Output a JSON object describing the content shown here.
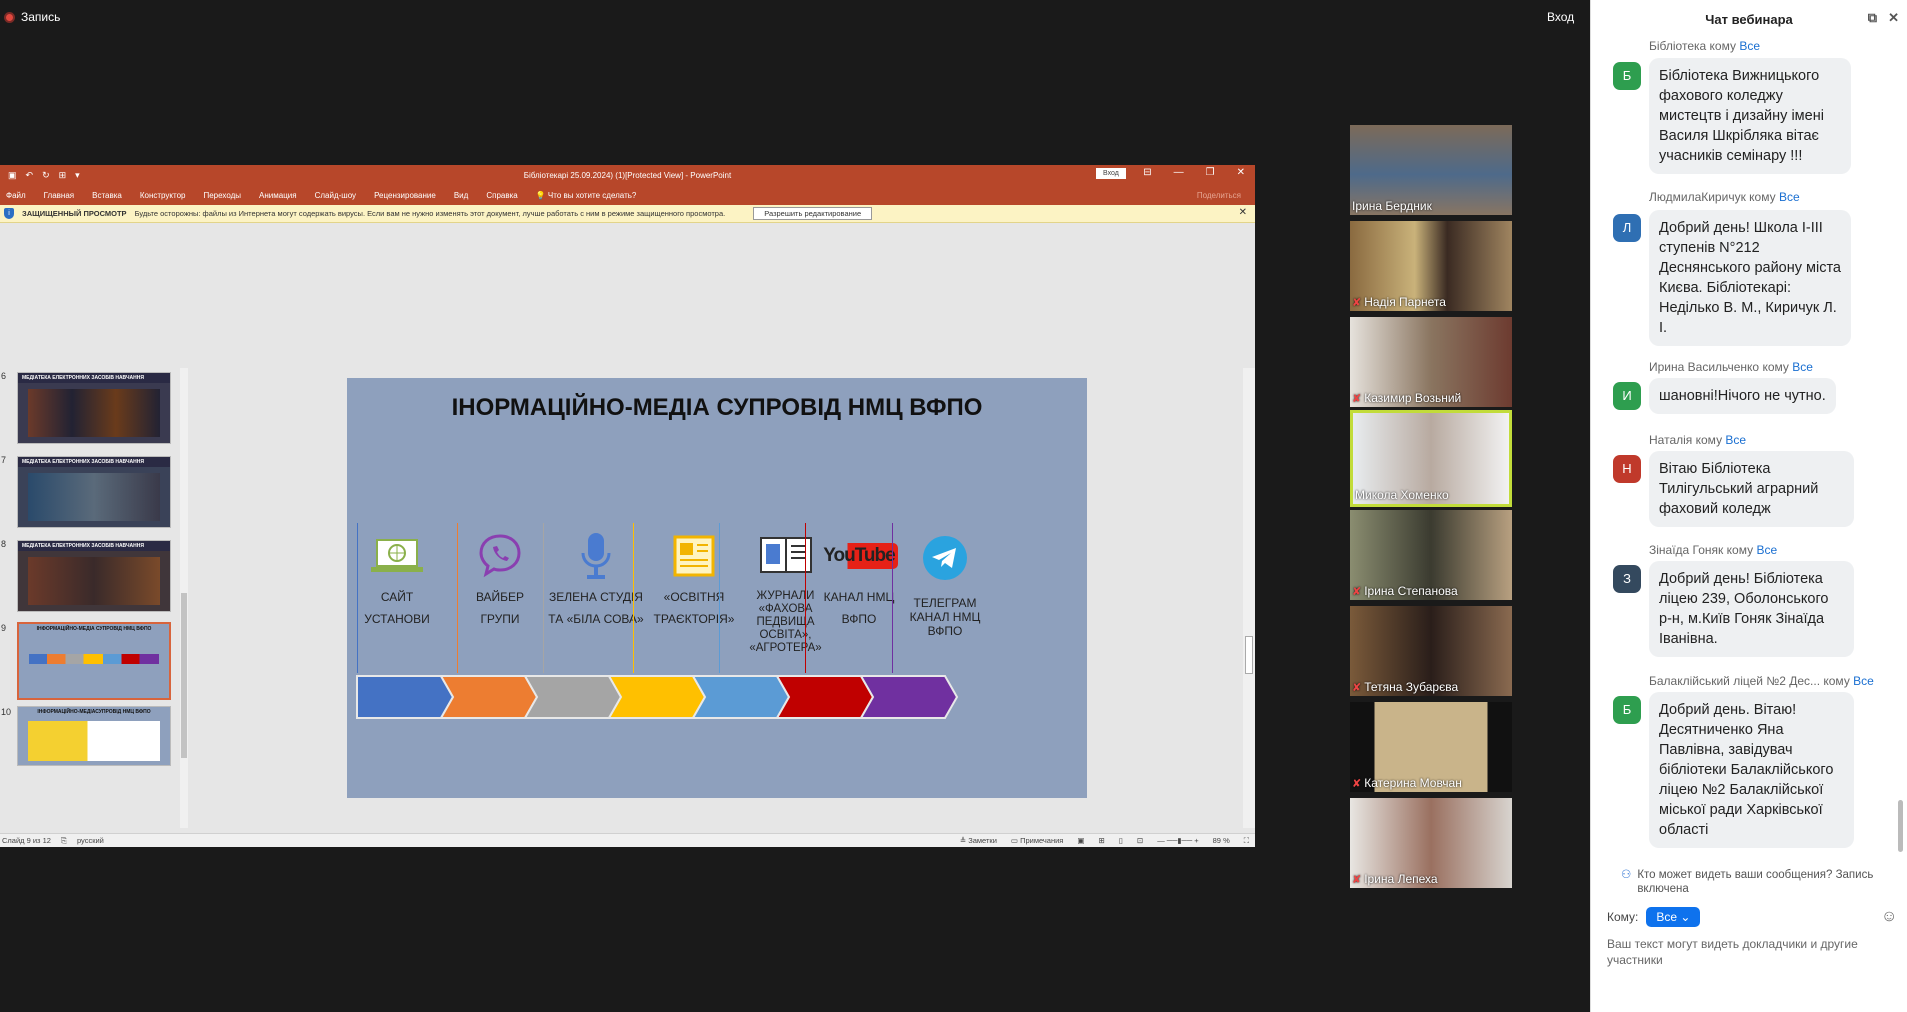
{
  "topbar": {
    "record_label": "Запись",
    "login_label": "Вход"
  },
  "ppt": {
    "title": "Бібліотекарі 25.09.2024) (1)[Protected View] - PowerPoint",
    "signin": "Вход",
    "menu": [
      "Файл",
      "Главная",
      "Вставка",
      "Конструктор",
      "Переходы",
      "Анимация",
      "Слайд-шоу",
      "Рецензирование",
      "Вид",
      "Справка",
      "Что вы хотите сделать?"
    ],
    "share": "Поделиться",
    "protected_title": "ЗАЩИЩЕННЫЙ ПРОСМОТР",
    "protected_text": "Будьте осторожны: файлы из Интернета могут содержать вирусы. Если вам не нужно изменять этот документ, лучше работать с ним в режиме защищенного просмотра.",
    "enable_edit": "Разрешить редактирование",
    "thumbnails": [
      {
        "num": "6",
        "header": "МЕДІАТЕКА ЕЛЕКТРОННИХ ЗАСОБІВ НАВЧАННЯ"
      },
      {
        "num": "7",
        "header": "МЕДІАТЕКА ЕЛЕКТРОННИХ ЗАСОБІВ НАВЧАННЯ"
      },
      {
        "num": "8",
        "header": "МЕДІАТЕКА ЕЛЕКТРОННИХ ЗАСОБІВ НАВЧАННЯ"
      },
      {
        "num": "9",
        "header": "ІНФОРМАЦІЙНО-МЕДІА СУПРОВІД НМЦ ВФПО"
      },
      {
        "num": "10",
        "header": "ІНФОРМАЦІЙНО-МЕДІАСУПРОВІД НМЦ ВФПО"
      }
    ],
    "slide": {
      "title": "ІНОРМАЦІЙНО-МЕДІА СУПРОВІД НМЦ ВФПО",
      "columns": [
        {
          "label": "САЙТ УСТАНОВИ",
          "icon": "laptop-icon",
          "color": "#4472c4"
        },
        {
          "label": "ВАЙБЕР ГРУПИ",
          "icon": "viber-icon",
          "color": "#ed7d31"
        },
        {
          "label": "ЗЕЛЕНА СТУДІЯ ТА «БІЛА СОВА»",
          "icon": "microphone-icon",
          "color": "#a5a5a5"
        },
        {
          "label": "«ОСВІТНЯ ТРАЄКТОРІЯ»",
          "icon": "newspaper-icon",
          "color": "#ffc000"
        },
        {
          "label": "ЖУРНАЛИ «ФАХОВА ПЕДВИЩА ОСВІТА», «АГРОТЕРА»",
          "icon": "book-icon",
          "color": "#5b9bd5"
        },
        {
          "label": "КАНАЛ НМЦ ВФПО",
          "icon": "youtube-icon",
          "color": "#c00000"
        },
        {
          "label": "ТЕЛЕГРАМ КАНАЛ НМЦ ВФПО",
          "icon": "telegram-icon",
          "color": "#7030a0"
        }
      ],
      "youtube_text": "YouTube"
    },
    "status": {
      "slide": "Слайд 9 из 12",
      "lang": "русский",
      "notes": "Заметки",
      "comments": "Примечания",
      "zoom": "89 %"
    }
  },
  "participants": [
    {
      "name": "Ірина Бердник",
      "bg": "#6b5a48"
    },
    {
      "name": "Надія Парнета",
      "bg": "#8a6a40"
    },
    {
      "name": "Казимир Возьний",
      "bg": "#7a6350"
    },
    {
      "name": "Микола Хоменко",
      "bg": "#c9ccd2",
      "active": true
    },
    {
      "name": "Ірина Степанова",
      "bg": "#6f7150"
    },
    {
      "name": "Тетяна Зубарєва",
      "bg": "#5a4d3e"
    },
    {
      "name": "Катерина Мовчан",
      "bg": "#8f8570"
    },
    {
      "name": "Ірина Лепеха",
      "bg": "#c3c1be"
    }
  ],
  "chat": {
    "title": "Чат вебинара",
    "messages": [
      {
        "sender": "Бібліотека",
        "to_label": "кому",
        "to": "Все",
        "initial": "Б",
        "color": "#2e9e4f",
        "text": "Бібліотека Вижницького фахового коледжу мистецтв і дизайну імені Василя Шкрібляка вітає учасників семінару !!!"
      },
      {
        "sender": "ЛюдмилаКиричук",
        "to_label": "кому",
        "to": "Все",
        "initial": "Л",
        "color": "#2f6fb3",
        "text": "Добрий день! Школа І-ІІІ ступенів N°212 Деснянського району міста Києва. Бібліотекарі: Неділько В. М., Киричук Л. І."
      },
      {
        "sender": "Ирина Васильченко",
        "to_label": "кому",
        "to": "Все",
        "initial": "И",
        "color": "#2e9e4f",
        "text": "шановні!Нічого не чутно."
      },
      {
        "sender": "Наталія",
        "to_label": "кому",
        "to": "Все",
        "initial": "Н",
        "color": "#c0392b",
        "text": "Вітаю Бібліотека Тилігульський аграрний фаховий коледж"
      },
      {
        "sender": "Зінаїда Гоняк",
        "to_label": "кому",
        "to": "Все",
        "initial": "З",
        "color": "#34495e",
        "text": "Добрий день! Бібліотека ліцею  239, Оболонського р-н, м.Київ Гоняк  Зінаїда Іванівна."
      },
      {
        "sender": "Балаклійський ліцей №2 Дес...",
        "to_label": "кому",
        "to": "Все",
        "initial": "Б",
        "color": "#2e9e4f",
        "text": "Добрий день. Вітаю! Десятниченко Яна Павлівна, завідувач бібліотеки Балаклійського ліцею №2 Балаклійської міської ради Харківської області"
      }
    ],
    "notice": "Кто может видеть ваши сообщения? Запись включена",
    "to_label": "Кому:",
    "to_value": "Все",
    "placeholder": "Ваш текст могут видеть докладчики и другие участники"
  }
}
